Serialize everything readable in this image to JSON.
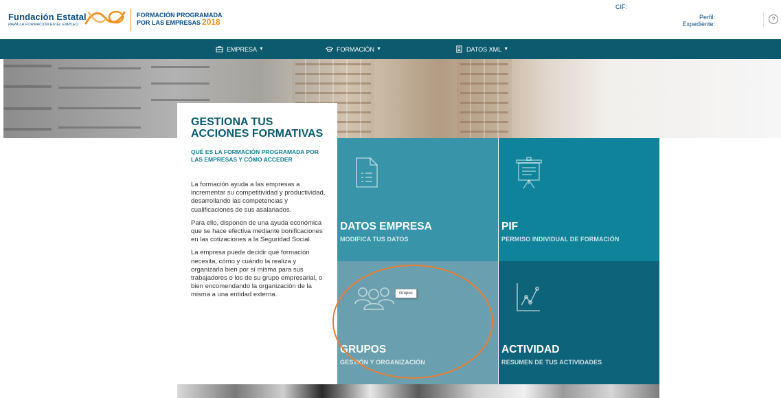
{
  "header": {
    "logo_title": "Fundación Estatal",
    "logo_sub": "PARA LA FORMACIÓN EN EL EMPLEO",
    "fp_line1": "FORMACIÓN PROGRAMADA",
    "fp_line2": "POR LAS EMPRESAS",
    "fp_year": "2018",
    "cif_label": "CIF:",
    "perfil_label": "Perfil:",
    "expediente_label": "Expediente:",
    "help_glyph": "?"
  },
  "nav": {
    "items": [
      {
        "label": "EMPRESA",
        "icon": "briefcase-icon"
      },
      {
        "label": "FORMACIÓN",
        "icon": "graduation-cap-icon"
      },
      {
        "label": "DATOS XML",
        "icon": "document-icon"
      }
    ]
  },
  "info": {
    "title": "GESTIONA TUS ACCIONES FORMATIVAS",
    "subtitle": "QUÉ ES LA FORMACIÓN PROGRAMADA POR LAS EMPRESAS Y CÓMO ACCEDER",
    "paragraphs": [
      "La formación ayuda a las empresas a incrementar su competitividad y productividad, desarrollando las competencias y cualificaciones de sus asalariados.",
      "Para ello, disponen de una ayuda económica que se hace efectiva mediante bonificaciones en las cotizaciones a la Seguridad Social.",
      "La empresa puede decidir qué formación necesita, cómo y cuándo la realiza y organizarla bien por sí misma para sus trabajadores o los de su grupo empresarial, o bien encomendando la organización de la misma a una entidad externa."
    ]
  },
  "tiles": {
    "datos": {
      "title": "DATOS EMPRESA",
      "subtitle": "MODIFICA TUS DATOS",
      "icon": "document-list-icon"
    },
    "pif": {
      "title": "PIF",
      "subtitle": "PERMISO INDIVIDUAL DE FORMACIÓN",
      "icon": "presentation-board-icon"
    },
    "grupos": {
      "title": "GRUPOS",
      "subtitle": "GESTIÓN Y ORGANIZACIÓN",
      "icon": "users-group-icon",
      "tooltip": "Grupos"
    },
    "actividad": {
      "title": "ACTIVIDAD",
      "subtitle": "RESUMEN DE TUS ACTIVIDADES",
      "icon": "line-chart-icon"
    }
  },
  "colors": {
    "nav_bg": "#0c5a6e",
    "brand_blue": "#0b4f88",
    "brand_orange": "#f09223",
    "tile_datos": "#3794a9",
    "tile_pif": "#0e839a",
    "tile_grupos": "#699fae",
    "tile_actividad": "#0d6379",
    "highlight": "#ed7d31"
  }
}
